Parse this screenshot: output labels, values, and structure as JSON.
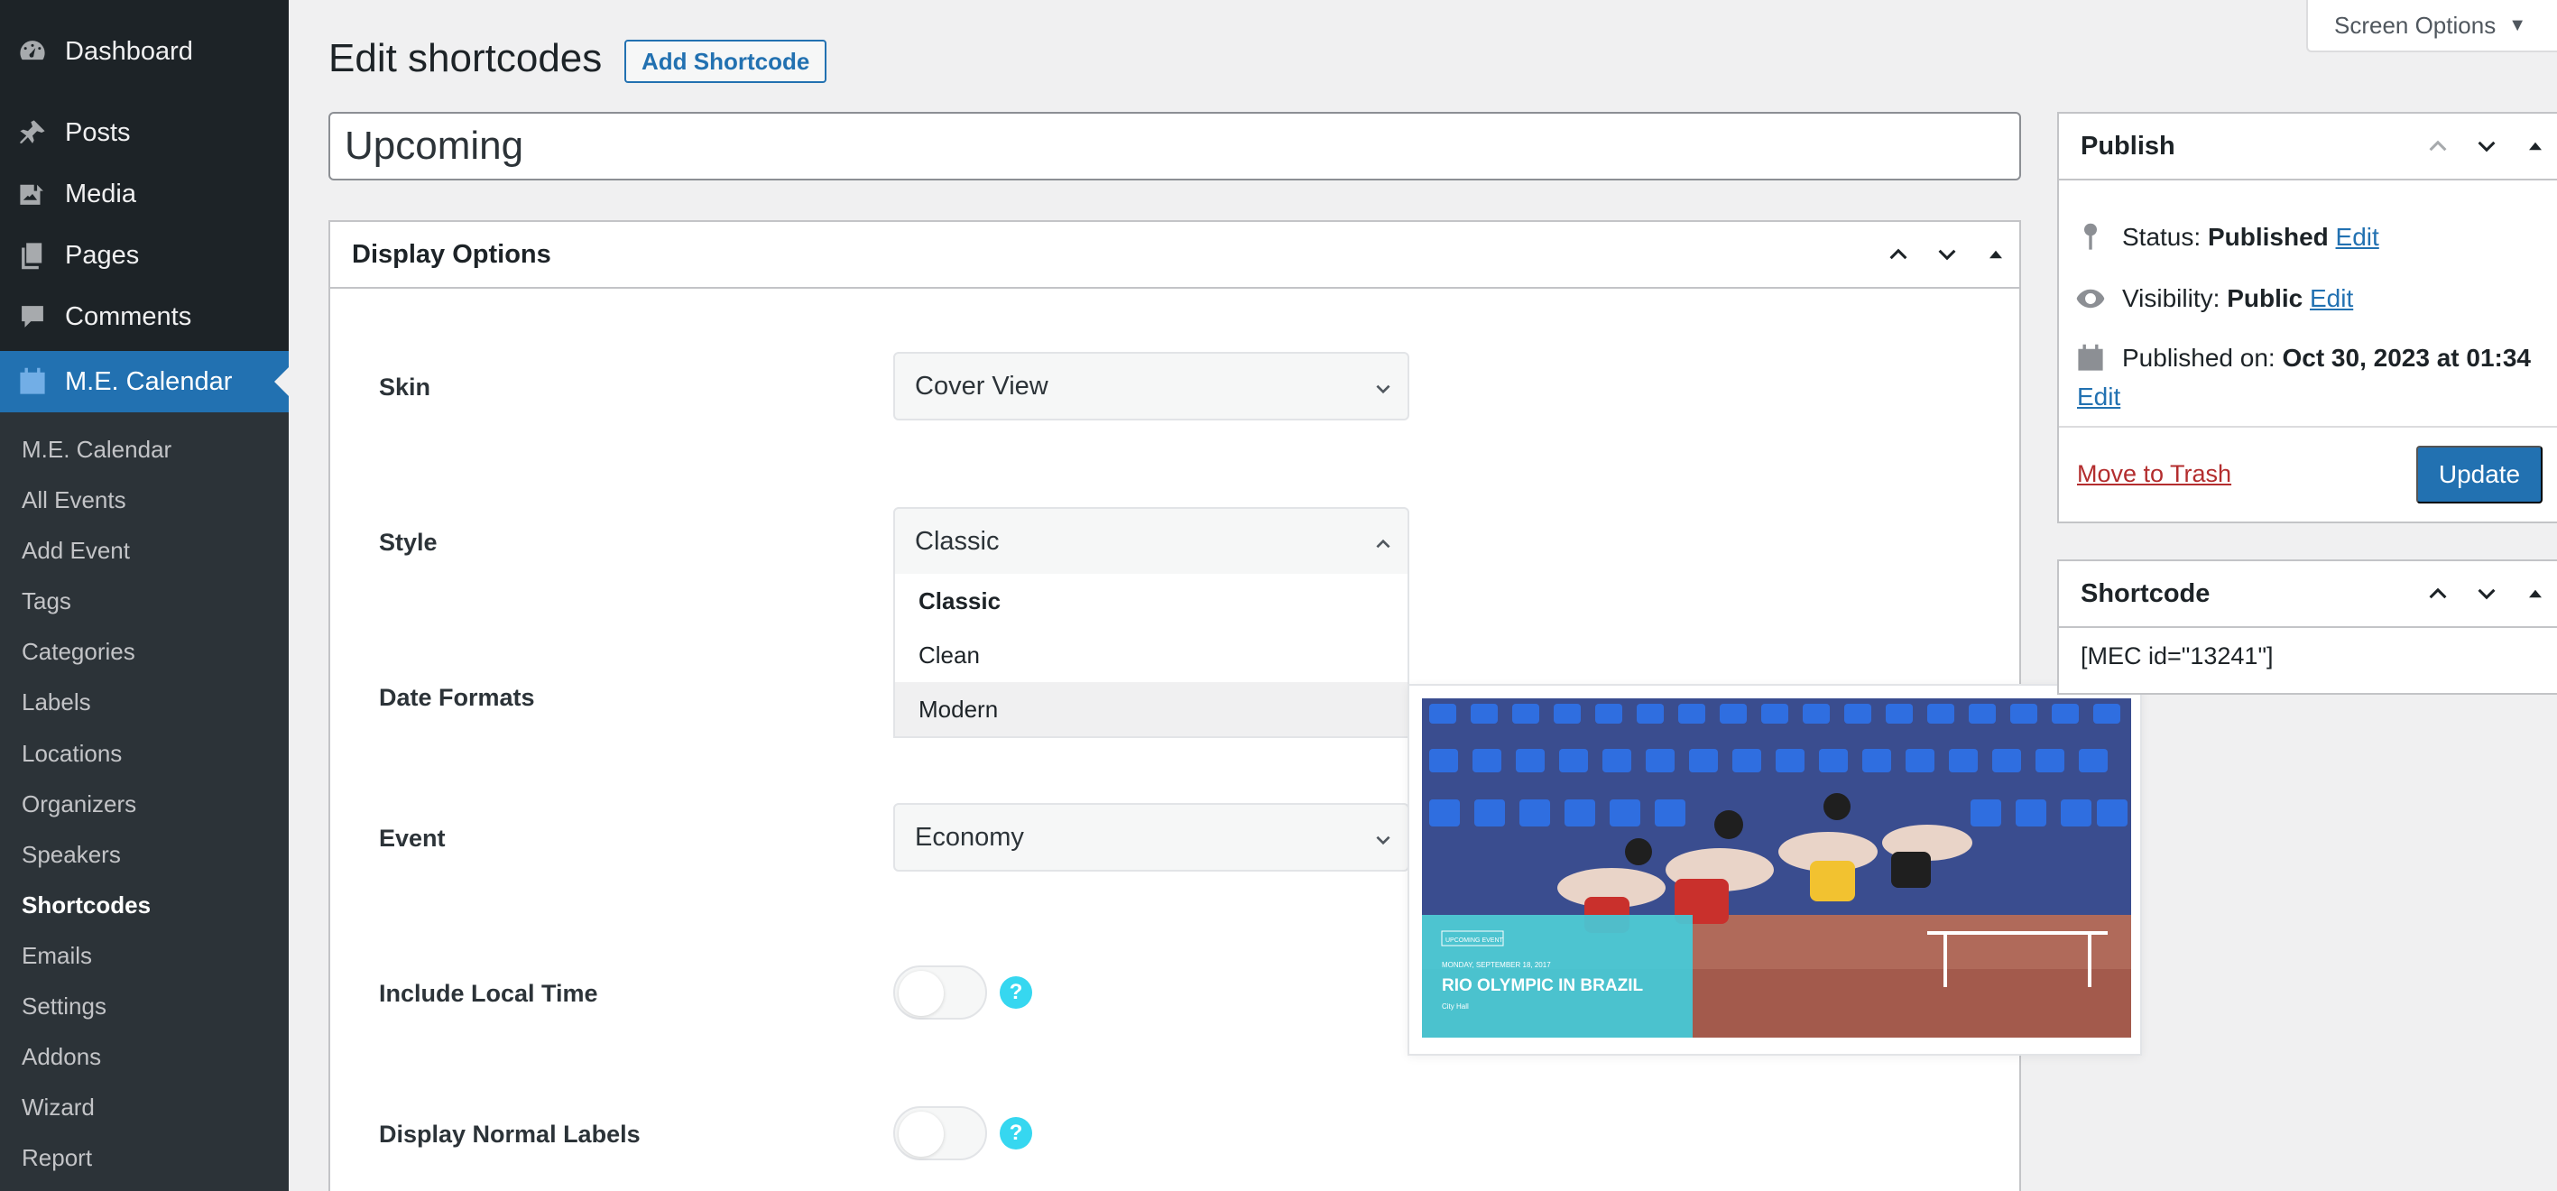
{
  "sidebar": {
    "menu": [
      {
        "label": "Dashboard",
        "icon": "dashboard-icon"
      },
      {
        "label": "Posts",
        "icon": "pin-icon"
      },
      {
        "label": "Media",
        "icon": "media-icon"
      },
      {
        "label": "Pages",
        "icon": "pages-icon"
      },
      {
        "label": "Comments",
        "icon": "comment-icon"
      },
      {
        "label": "M.E. Calendar",
        "icon": "calendar-icon"
      }
    ],
    "submenu": [
      "M.E. Calendar",
      "All Events",
      "Add Event",
      "Tags",
      "Categories",
      "Labels",
      "Locations",
      "Organizers",
      "Speakers",
      "Shortcodes",
      "Emails",
      "Settings",
      "Addons",
      "Wizard",
      "Report"
    ],
    "current_submenu": "Shortcodes"
  },
  "header": {
    "title": "Edit shortcodes",
    "add_button": "Add Shortcode",
    "screen_options": "Screen Options"
  },
  "post_title": "Upcoming",
  "display_options": {
    "title": "Display Options",
    "fields": {
      "skin": {
        "label": "Skin",
        "value": "Cover View"
      },
      "style": {
        "label": "Style",
        "value": "Classic",
        "options": [
          "Classic",
          "Clean",
          "Modern"
        ],
        "hovered": "Modern"
      },
      "date_formats": {
        "label": "Date Formats"
      },
      "event": {
        "label": "Event",
        "value": "Economy"
      },
      "local_time": {
        "label": "Include Local Time",
        "enabled": false
      },
      "normal_labels": {
        "label": "Display Normal Labels",
        "enabled": false
      }
    },
    "help_glyph": "?"
  },
  "preview": {
    "badge": "UPCOMING EVENT",
    "date": "MONDAY, SEPTEMBER 18, 2017",
    "title": "RIO OLYMPIC IN BRAZIL",
    "location": "City Hall"
  },
  "publish": {
    "title": "Publish",
    "status_label": "Status:",
    "status_value": "Published",
    "visibility_label": "Visibility:",
    "visibility_value": "Public",
    "published_on_label": "Published on:",
    "published_on_value": "Oct 30, 2023 at 01:34",
    "edit_link": "Edit",
    "trash_link": "Move to Trash",
    "update_button": "Update"
  },
  "shortcode": {
    "title": "Shortcode",
    "value": "[MEC id=\"13241\"]"
  },
  "colors": {
    "sidebar_bg": "#1d2327",
    "submenu_bg": "#2c3338",
    "accent": "#2271b1",
    "help": "#36d7f0",
    "trash": "#b32d2e",
    "preview_overlay": "#3fd0e0"
  }
}
